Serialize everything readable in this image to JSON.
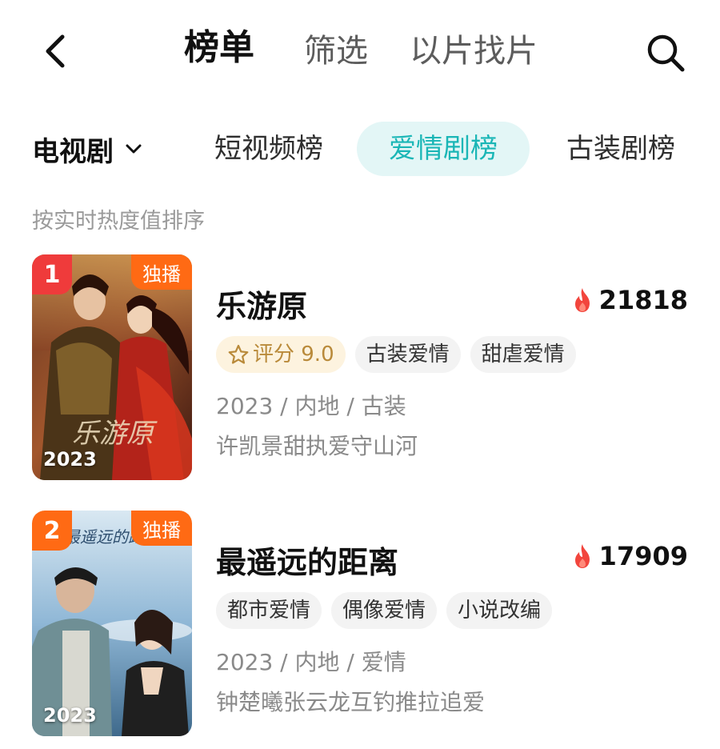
{
  "nav": {
    "tabs": [
      "榜单",
      "筛选",
      "以片找片"
    ],
    "active_tab": "榜单"
  },
  "category": {
    "dropdown_label": "电视剧",
    "chips": [
      "短视频榜",
      "爱情剧榜",
      "古装剧榜"
    ],
    "active_chip": "爱情剧榜"
  },
  "sort_hint": "按实时热度值排序",
  "items": [
    {
      "rank": "1",
      "badge": "独播",
      "poster_year": "2023",
      "title": "乐游原",
      "heat": "21818",
      "rating": "评分 9.0",
      "tags": [
        "古装爱情",
        "甜虐爱情"
      ],
      "meta": "2023 / 内地 / 古装",
      "desc": "许凯景甜执爱守山河"
    },
    {
      "rank": "2",
      "badge": "独播",
      "poster_year": "2023",
      "title": "最遥远的距离",
      "heat": "17909",
      "tags": [
        "都市爱情",
        "偶像爱情",
        "小说改编"
      ],
      "meta": "2023 / 内地 / 爱情",
      "desc": "钟楚曦张云龙互钓推拉追爱"
    }
  ],
  "colors": {
    "accent": "#1ab6b6",
    "accent_bg": "#e3f6f6",
    "rank1": "#ef3b3b",
    "rank2": "#ff6a14",
    "exclusive": "#ff6a14",
    "heat_flame": "#f2453d",
    "rating_text": "#b98a3a",
    "rating_bg": "#fdf3df"
  },
  "icons": {
    "back": "chevron-left-icon",
    "search": "search-icon",
    "dropdown": "chevron-down-icon",
    "heat": "flame-icon",
    "rating": "star-outline-icon"
  }
}
